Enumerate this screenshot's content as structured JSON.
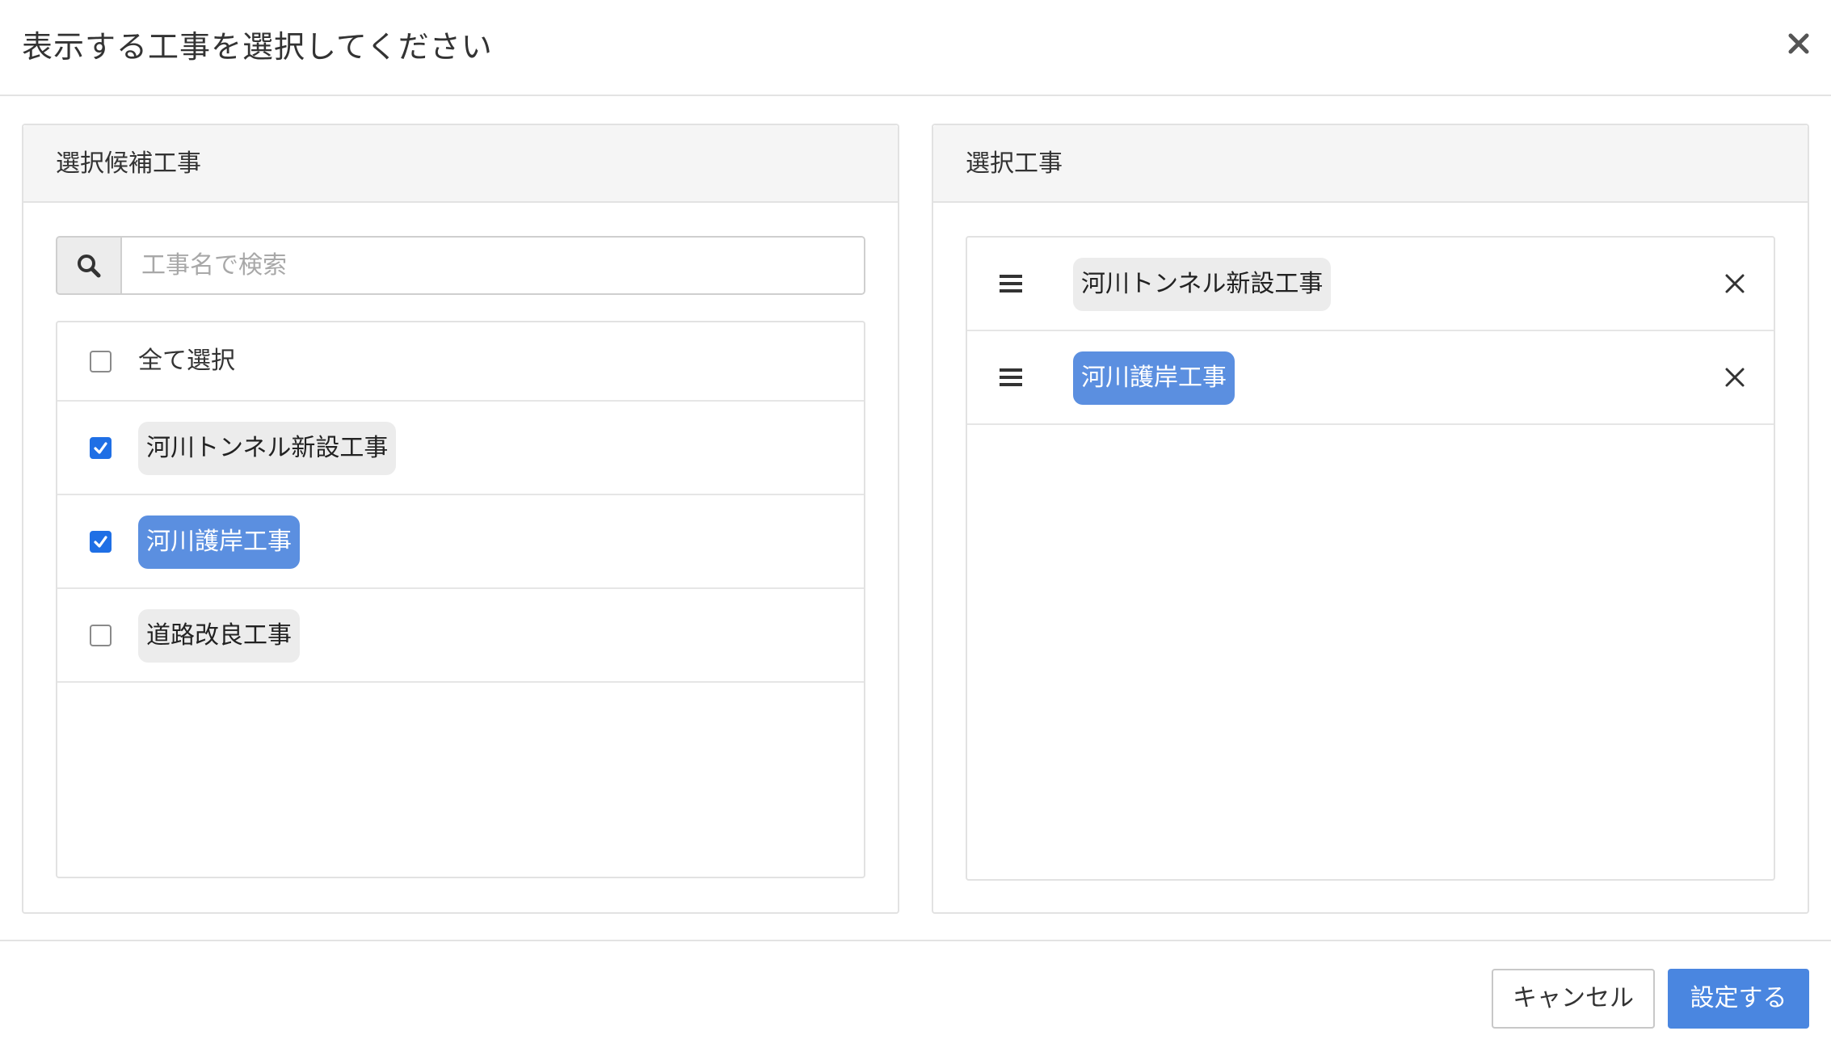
{
  "dialog": {
    "title": "表示する工事を選択してください",
    "close_icon": "close-icon"
  },
  "candidates_panel": {
    "title": "選択候補工事",
    "search": {
      "icon": "search-icon",
      "placeholder": "工事名で検索",
      "value": ""
    },
    "select_all": {
      "label": "全て選択",
      "checked": false
    },
    "items": [
      {
        "label": "河川トンネル新設工事",
        "checked": true,
        "highlight": false
      },
      {
        "label": "河川護岸工事",
        "checked": true,
        "highlight": true
      },
      {
        "label": "道路改良工事",
        "checked": false,
        "highlight": false
      }
    ]
  },
  "selected_panel": {
    "title": "選択工事",
    "items": [
      {
        "label": "河川トンネル新設工事",
        "highlight": false,
        "handle_icon": "drag-handle-icon",
        "remove_icon": "remove-icon"
      },
      {
        "label": "河川護岸工事",
        "highlight": true,
        "handle_icon": "drag-handle-icon",
        "remove_icon": "remove-icon"
      }
    ]
  },
  "footer": {
    "cancel_label": "キャンセル",
    "submit_label": "設定する"
  },
  "colors": {
    "accent": "#4a86e0",
    "chip_highlight": "#5b8fe0",
    "chip_default": "#ececec",
    "checkbox_checked": "#1f6fe5"
  }
}
